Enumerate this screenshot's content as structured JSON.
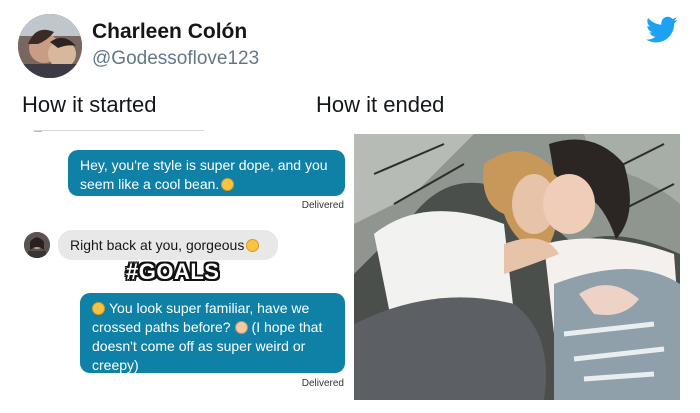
{
  "tweet": {
    "display_name": "Charleen Colón",
    "handle": "@Godessoflove123",
    "logo": "twitter-bird-icon",
    "brand_color": "#1da1f2"
  },
  "columns": {
    "left_title": "How it started",
    "right_title": "How it ended"
  },
  "chat": {
    "message_1": "Hey, you're style is super dope, and you seem like a cool bean.",
    "delivered_1": "Delivered",
    "reply": "Right back at you, gorgeous",
    "overlay_caption": "#GOALS",
    "message_2": "You look super familiar, have we crossed paths before?",
    "message_2_tail": "(I hope that doesn't come off as super weird or creepy)",
    "delivered_2": "Delivered",
    "bubble_color": "#0f80a6"
  },
  "photo": {
    "icon": "couple-photo"
  }
}
